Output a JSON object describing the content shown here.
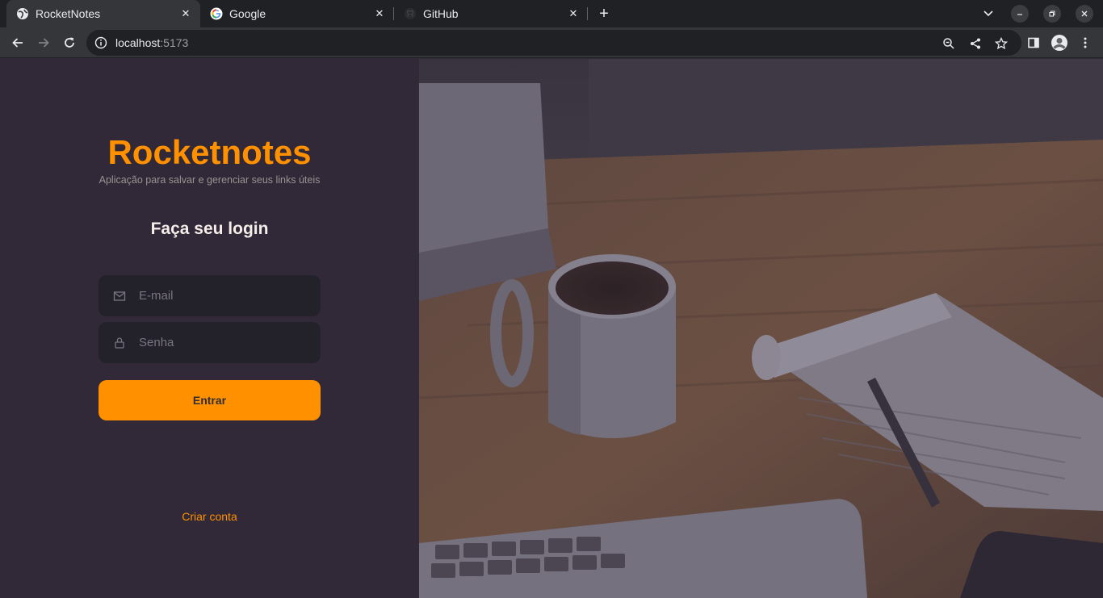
{
  "browser": {
    "tabs": [
      {
        "title": "RocketNotes",
        "icon": "globe-icon",
        "active": true
      },
      {
        "title": "Google",
        "icon": "google-icon",
        "active": false
      },
      {
        "title": "GitHub",
        "icon": "github-icon",
        "active": false
      }
    ],
    "new_tab_label": "+",
    "url_host": "localhost",
    "url_port": ":5173"
  },
  "page": {
    "brand": "Rocketnotes",
    "tagline": "Aplicação para salvar e gerenciar seus links úteis",
    "heading": "Faça seu login",
    "email_placeholder": "E-mail",
    "password_placeholder": "Senha",
    "enter_button": "Entrar",
    "create_account_link": "Criar conta"
  },
  "colors": {
    "accent": "#ff9000",
    "background": "#312838",
    "input_background": "#232129",
    "text": "#f4ede8",
    "muted": "#999591"
  },
  "background_image": "coffee-mug-notebook-laptop-photo"
}
